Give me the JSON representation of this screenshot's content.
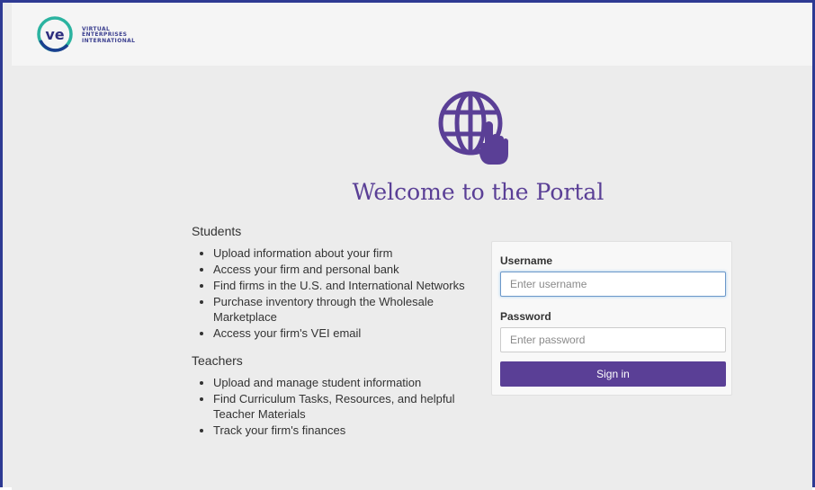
{
  "brand": {
    "logo_lines": [
      "VIRTUAL",
      "ENTERPRISES",
      "INTERNATIONAL"
    ],
    "colors": {
      "primary": "#5a3f96",
      "logo_ring": "#2bb3a0",
      "frame": "#2e3a93"
    }
  },
  "hero": {
    "icon": "globe-hand-icon",
    "title": "Welcome to the Portal"
  },
  "students": {
    "heading": "Students",
    "items": [
      "Upload information about your firm",
      "Access your firm and personal bank",
      "Find firms in the U.S. and International Networks",
      "Purchase inventory through the Wholesale Marketplace",
      "Access your firm's VEI email"
    ]
  },
  "teachers": {
    "heading": "Teachers",
    "items": [
      "Upload and manage student information",
      "Find Curriculum Tasks, Resources, and helpful Teacher Materials",
      "Track your firm's finances"
    ]
  },
  "login": {
    "username_label": "Username",
    "username_placeholder": "Enter username",
    "password_label": "Password",
    "password_placeholder": "Enter password",
    "signin_label": "Sign in"
  }
}
